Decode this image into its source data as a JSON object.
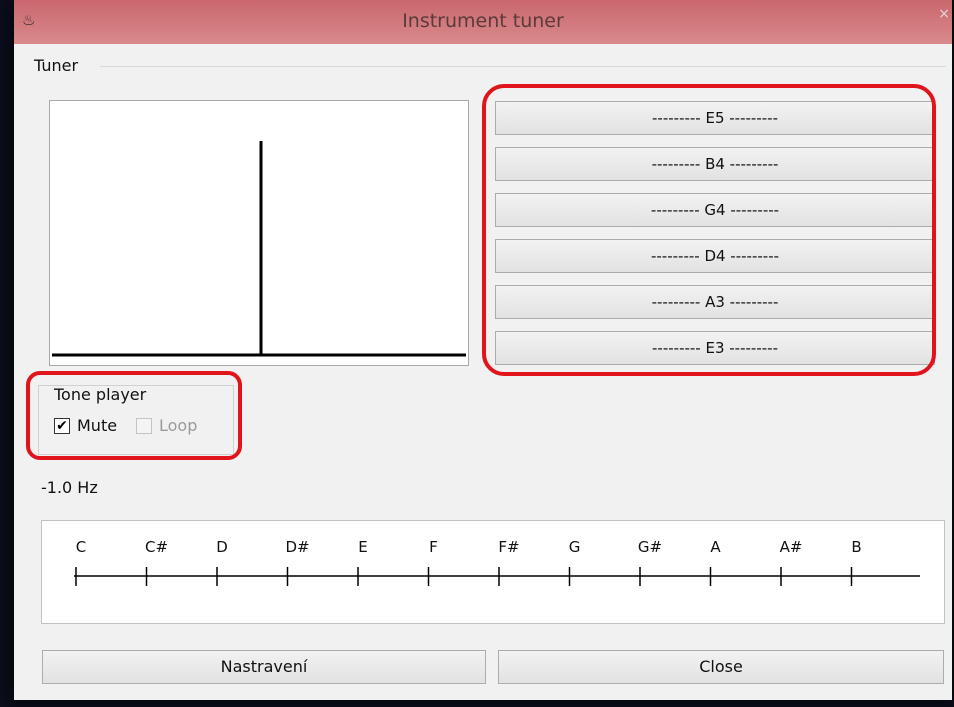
{
  "window": {
    "title": "Instrument tuner",
    "icon": "tuning-fork-icon",
    "close_glyph": "×"
  },
  "tuner": {
    "group_label": "Tuner",
    "strings": [
      "--------- E5 ---------",
      "--------- B4 ---------",
      "--------- G4 ---------",
      "--------- D4 ---------",
      "--------- A3 ---------",
      "--------- E3 ---------"
    ]
  },
  "tone_player": {
    "label": "Tone player",
    "mute_label": "Mute",
    "mute_checked": true,
    "loop_label": "Loop",
    "loop_checked": false,
    "loop_enabled": false
  },
  "frequency_readout": "-1.0 Hz",
  "note_scale": [
    "C",
    "C#",
    "D",
    "D#",
    "E",
    "F",
    "F#",
    "G",
    "G#",
    "A",
    "A#",
    "B"
  ],
  "buttons": {
    "settings": "Nastravení",
    "close": "Close"
  },
  "colors": {
    "highlight": "#e0141a",
    "titlebar": "#d07a7e"
  }
}
